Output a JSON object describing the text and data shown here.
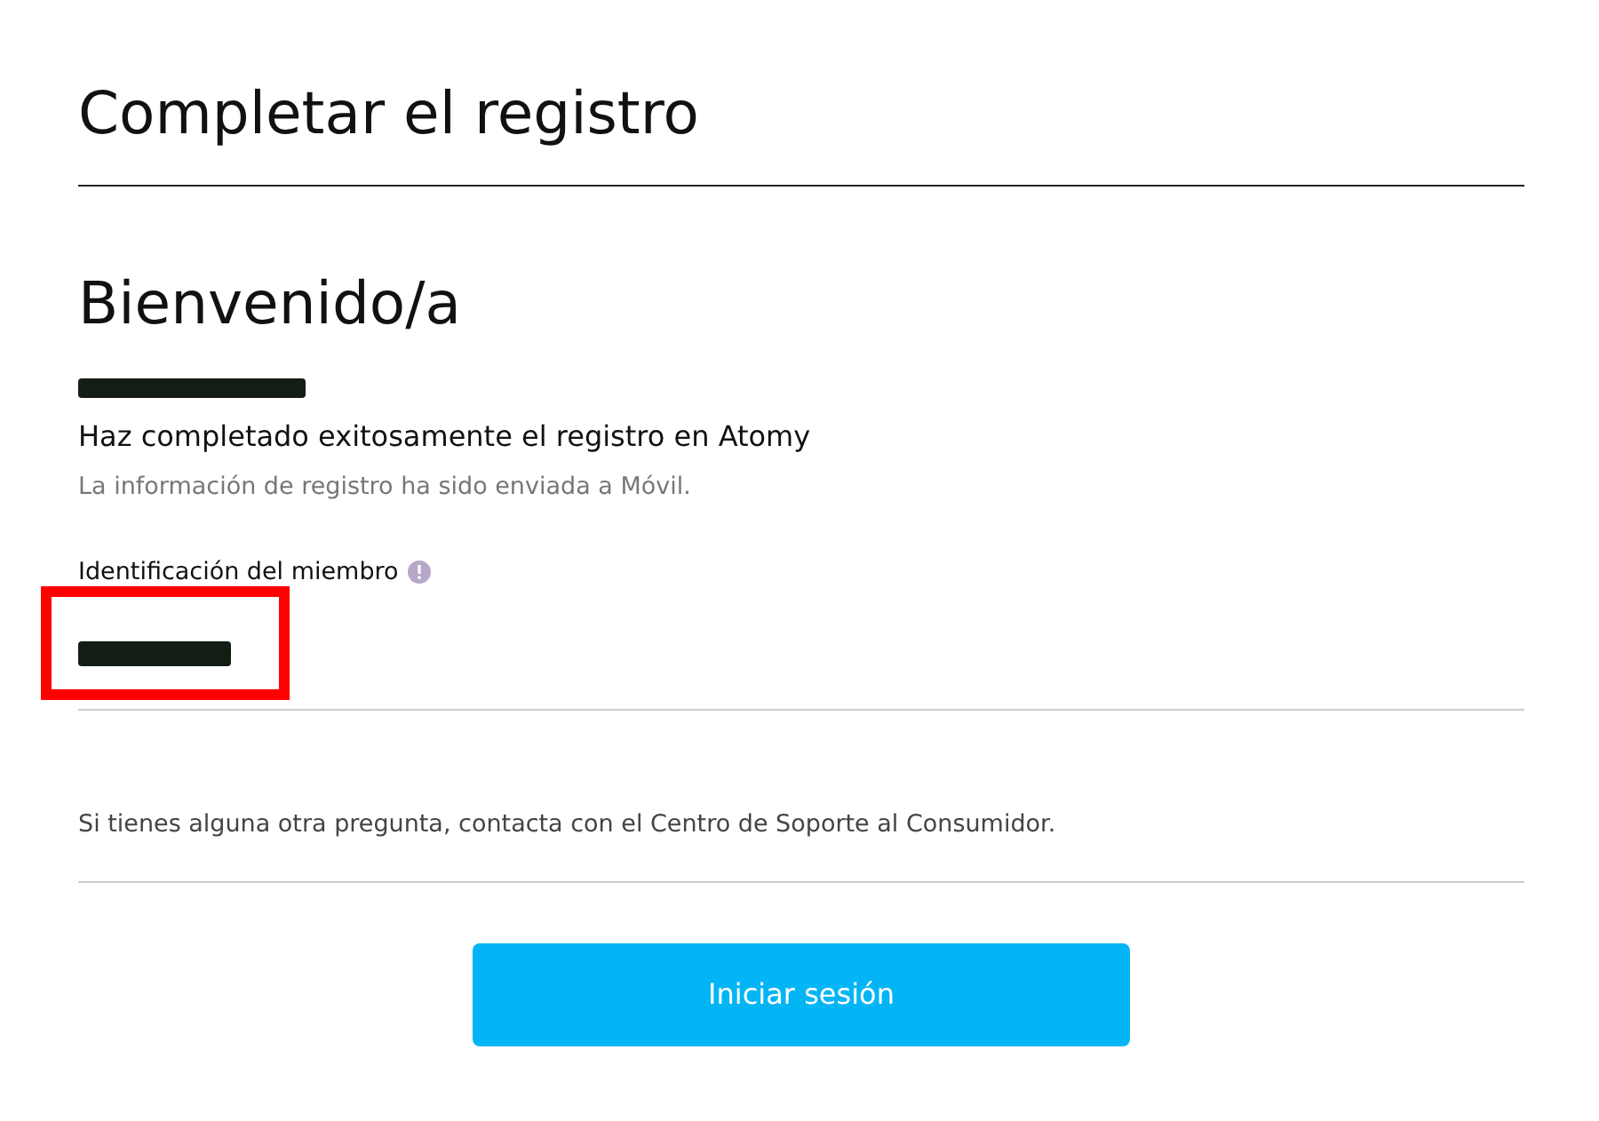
{
  "page_title": "Completar el registro",
  "welcome": "Bienvenido/a",
  "success_message": "Haz completado exitosamente el registro en Atomy",
  "info_message": "La información de registro ha sido enviada a Móvil.",
  "member_id": {
    "label": "Identificación del miembro",
    "highlighted": true
  },
  "support_note": "Si tienes alguna otra pregunta, contacta con el Centro de Soporte al Consumidor.",
  "login_button": "Iniciar sesión"
}
